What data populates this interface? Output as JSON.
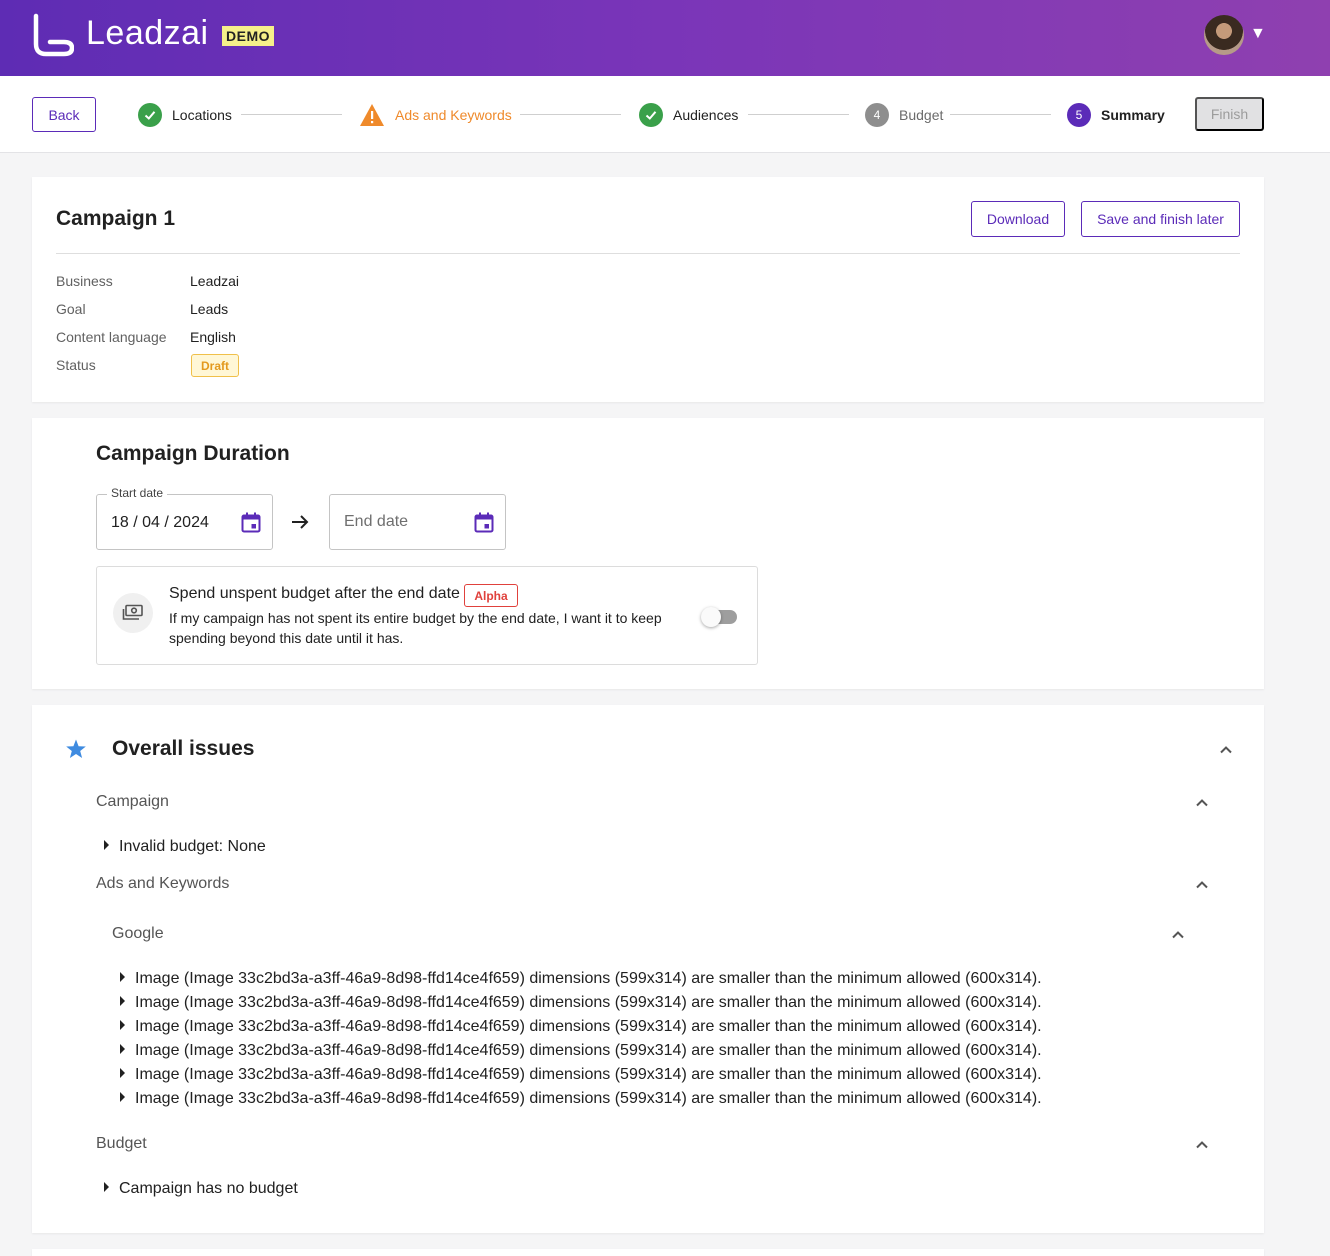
{
  "header": {
    "brand": "Leadzai",
    "badge": "DEMO"
  },
  "stepper": {
    "back_label": "Back",
    "steps": [
      {
        "label": "Locations",
        "state": "complete",
        "icon": "check-icon"
      },
      {
        "label": "Ads and Keywords",
        "state": "warning",
        "icon": "warning-icon"
      },
      {
        "label": "Audiences",
        "state": "complete",
        "icon": "check-icon"
      },
      {
        "label": "Budget",
        "state": "pending",
        "number": "4"
      },
      {
        "label": "Summary",
        "state": "active",
        "number": "5"
      }
    ],
    "finish_label": "Finish"
  },
  "campaign": {
    "title": "Campaign 1",
    "download_label": "Download",
    "save_label": "Save and finish later",
    "fields": [
      {
        "label": "Business",
        "value": "Leadzai"
      },
      {
        "label": "Goal",
        "value": "Leads"
      },
      {
        "label": "Content language",
        "value": "English"
      },
      {
        "label": "Status",
        "value": "Draft"
      }
    ]
  },
  "duration": {
    "title": "Campaign Duration",
    "start_label": "Start date",
    "start_value": "18 / 04 / 2024",
    "end_placeholder": "End date",
    "spend_title": "Spend unspent budget after the end date",
    "alpha_label": "Alpha",
    "spend_desc": "If my campaign has not spent its entire budget by the end date, I want it to keep spending beyond this date until it has.",
    "toggle_on": false
  },
  "issues": {
    "title": "Overall issues",
    "campaign_label": "Campaign",
    "campaign_items": [
      "Invalid budget: None"
    ],
    "ads_label": "Ads and Keywords",
    "google_label": "Google",
    "google_items": [
      "Image (Image 33c2bd3a-a3ff-46a9-8d98-ffd14ce4f659) dimensions (599x314) are smaller than the minimum allowed (600x314).",
      "Image (Image 33c2bd3a-a3ff-46a9-8d98-ffd14ce4f659) dimensions (599x314) are smaller than the minimum allowed (600x314).",
      "Image (Image 33c2bd3a-a3ff-46a9-8d98-ffd14ce4f659) dimensions (599x314) are smaller than the minimum allowed (600x314).",
      "Image (Image 33c2bd3a-a3ff-46a9-8d98-ffd14ce4f659) dimensions (599x314) are smaller than the minimum allowed (600x314).",
      "Image (Image 33c2bd3a-a3ff-46a9-8d98-ffd14ce4f659) dimensions (599x314) are smaller than the minimum allowed (600x314).",
      "Image (Image 33c2bd3a-a3ff-46a9-8d98-ffd14ce4f659) dimensions (599x314) are smaller than the minimum allowed (600x314)."
    ],
    "budget_label": "Budget",
    "budget_items": [
      "Campaign has no budget"
    ]
  },
  "colors": {
    "brand": "#5b2bb8",
    "success": "#3aa04a",
    "warning": "#ef8a2b",
    "alpha": "#e0413c"
  }
}
